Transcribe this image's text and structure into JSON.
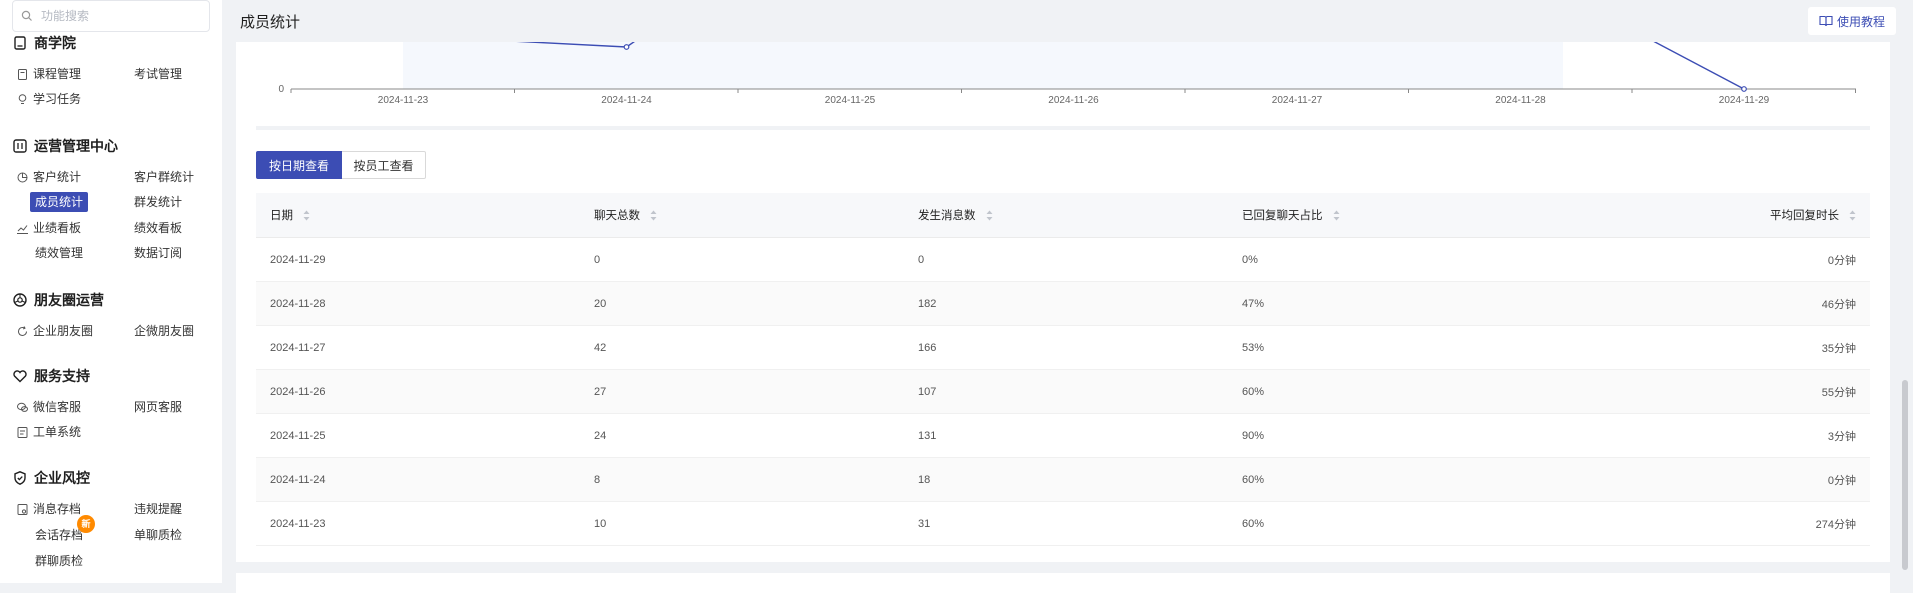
{
  "sidebar": {
    "search_placeholder": "功能搜索",
    "sections": {
      "academy": {
        "title": "商学院",
        "items": [
          "课程管理",
          "考试管理",
          "学习任务"
        ]
      },
      "ops": {
        "title": "运营管理中心",
        "items": [
          "客户统计",
          "客户群统计",
          "成员统计",
          "群发统计",
          "业绩看板",
          "绩效看板",
          "绩效管理",
          "数据订阅"
        ]
      },
      "moments": {
        "title": "朋友圈运营",
        "items": [
          "企业朋友圈",
          "企微朋友圈"
        ]
      },
      "service": {
        "title": "服务支持",
        "items": [
          "微信客服",
          "网页客服",
          "工单系统"
        ]
      },
      "risk": {
        "title": "企业风控",
        "items": [
          "消息存档",
          "违规提醒",
          "会话存档",
          "单聊质检",
          "群聊质检"
        ],
        "badge": "新"
      }
    }
  },
  "header": {
    "title": "成员统计",
    "tutorial_label": "使用教程"
  },
  "chart_data": {
    "type": "line",
    "x": [
      "2024-11-23",
      "2024-11-24",
      "2024-11-25",
      "2024-11-26",
      "2024-11-27",
      "2024-11-28",
      "2024-11-29"
    ],
    "y_tick_label": "0",
    "series_color": "#3c4db4"
  },
  "view_toggle": {
    "by_date": "按日期查看",
    "by_member": "按员工查看"
  },
  "table": {
    "columns": [
      "日期",
      "聊天总数",
      "发生消息数",
      "已回复聊天占比",
      "平均回复时长"
    ],
    "rows": [
      [
        "2024-11-29",
        "0",
        "0",
        "0%",
        "0分钟"
      ],
      [
        "2024-11-28",
        "20",
        "182",
        "47%",
        "46分钟"
      ],
      [
        "2024-11-27",
        "42",
        "166",
        "53%",
        "35分钟"
      ],
      [
        "2024-11-26",
        "27",
        "107",
        "60%",
        "55分钟"
      ],
      [
        "2024-11-25",
        "24",
        "131",
        "90%",
        "3分钟"
      ],
      [
        "2024-11-24",
        "8",
        "18",
        "60%",
        "0分钟"
      ],
      [
        "2024-11-23",
        "10",
        "31",
        "60%",
        "274分钟"
      ]
    ]
  }
}
